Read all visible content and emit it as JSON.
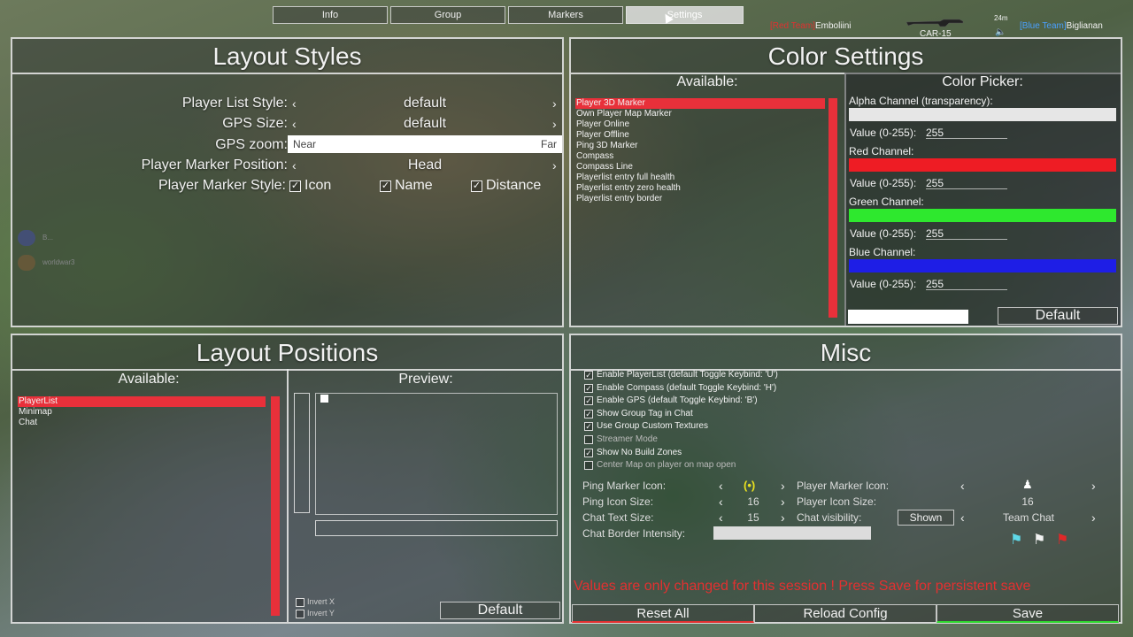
{
  "tabs": [
    {
      "label": "Info"
    },
    {
      "label": "Group"
    },
    {
      "label": "Markers"
    },
    {
      "label": "Settings"
    }
  ],
  "hud": {
    "left_team_tag": "[Red Team]",
    "left_player": "Emboliini",
    "weapon": "CAR-15",
    "distance": "24m",
    "right_team_tag": "[Blue Team]",
    "right_player": "Biglianan",
    "discord1": "B...",
    "discord2": "worldwar3"
  },
  "colors": {
    "accent_red": "#e8303a",
    "red_team": "#e03030",
    "blue_team": "#4aa0ff",
    "notice_red": "#e33030"
  },
  "layout_styles": {
    "title": "Layout Styles",
    "player_list_style": {
      "label": "Player List Style:",
      "value": "default"
    },
    "gps_size": {
      "label": "GPS Size:",
      "value": "default"
    },
    "gps_zoom": {
      "label": "GPS zoom:",
      "near": "Near",
      "far": "Far"
    },
    "player_marker_position": {
      "label": "Player Marker Position:",
      "value": "Head"
    },
    "player_marker_style": {
      "label": "Player Marker Style:",
      "options": [
        {
          "label": "Icon",
          "checked": true
        },
        {
          "label": "Name",
          "checked": true
        },
        {
          "label": "Distance",
          "checked": true
        }
      ]
    }
  },
  "color_settings": {
    "title": "Color Settings",
    "available_label": "Available:",
    "items": [
      "Player 3D Marker",
      "Own Player Map Marker",
      "Player Online",
      "Player Offline",
      "Ping 3D Marker",
      "Compass",
      "Compass Line",
      "Playerlist entry full health",
      "Playerlist entry zero health",
      "Playerlist entry border"
    ],
    "selected_index": 0,
    "picker": {
      "title": "Color Picker:",
      "alpha_label": "Alpha Channel (transparency):",
      "red_label": "Red Channel:",
      "green_label": "Green Channel:",
      "blue_label": "Blue Channel:",
      "value_label": "Value (0-255):",
      "alpha_value": "255",
      "red_value": "255",
      "green_value": "255",
      "blue_value": "255",
      "default_button": "Default"
    }
  },
  "layout_positions": {
    "title": "Layout Positions",
    "available_label": "Available:",
    "preview_label": "Preview:",
    "items": [
      "PlayerList",
      "Minimap",
      "Chat"
    ],
    "selected_index": 0,
    "invert_x": "Invert X",
    "invert_y": "Invert Y",
    "default_button": "Default"
  },
  "misc": {
    "title": "Misc",
    "checkboxes": [
      {
        "label": "Enable PlayerList (default Toggle Keybind: 'U')",
        "checked": true
      },
      {
        "label": "Enable Compass (default Toggle Keybind: 'H')",
        "checked": true
      },
      {
        "label": "Enable GPS (default Toggle Keybind: 'B')",
        "checked": true
      },
      {
        "label": "Show Group Tag in Chat",
        "checked": true
      },
      {
        "label": "Use Group Custom Textures",
        "checked": true
      },
      {
        "label": "Streamer Mode",
        "checked": false
      },
      {
        "label": "Show No Build Zones",
        "checked": true
      },
      {
        "label": "Center Map on player on map open",
        "checked": false
      }
    ],
    "ping_marker_icon_label": "Ping Marker Icon:",
    "ping_icon_size_label": "Ping Icon Size:",
    "ping_icon_size_value": "16",
    "chat_text_size_label": "Chat Text Size:",
    "chat_text_size_value": "15",
    "chat_border_intensity_label": "Chat Border Intensity:",
    "player_marker_icon_label": "Player Marker Icon:",
    "player_icon_size_label": "Player Icon Size:",
    "player_icon_size_value": "16",
    "chat_visibility_label": "Chat visibility:",
    "chat_visibility_value": "Shown",
    "chat_channel_value": "Team Chat",
    "notice": "Values are only changed for this session ! Press Save for persistent save",
    "reset_all": "Reset All",
    "reload_config": "Reload Config",
    "save": "Save"
  }
}
